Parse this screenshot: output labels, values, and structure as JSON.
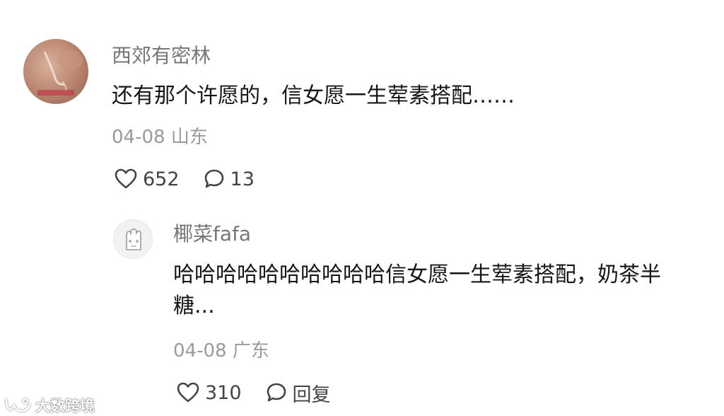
{
  "comment": {
    "username": "西郊有密林",
    "text": "还有那个许愿的，信女愿一生荤素搭配……",
    "date": "04-08",
    "location": "山东",
    "likes": "652",
    "replies": "13",
    "avatar_icon": "photo-avatar-icon"
  },
  "reply": {
    "username": "椰菜fafa",
    "text": "哈哈哈哈哈哈哈哈哈哈信女愿一生荤素搭配，奶茶半糖...",
    "date": "04-08",
    "location": "广东",
    "likes": "310",
    "reply_label": "回复",
    "avatar_icon": "cat-paw-avatar-icon"
  },
  "watermark": {
    "text": "大数跨境"
  },
  "colors": {
    "text_primary": "#161616",
    "text_secondary": "#777777",
    "text_meta": "#9a9a9a",
    "icon": "#444444"
  }
}
